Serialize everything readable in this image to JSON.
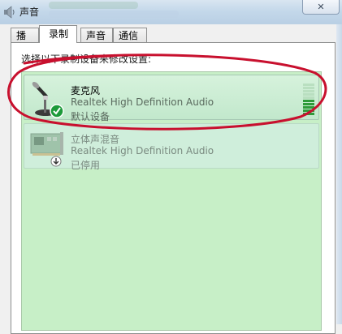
{
  "window": {
    "title": "声音",
    "close_symbol": "✕"
  },
  "tabs": [
    {
      "label": "播放",
      "active": false
    },
    {
      "label": "录制",
      "active": true
    },
    {
      "label": "声音",
      "active": false
    },
    {
      "label": "通信",
      "active": false
    }
  ],
  "recording": {
    "instruction": "选择以下录制设备来修改设置:",
    "devices": [
      {
        "name": "麦克风",
        "driver": "Realtek High Definition Audio",
        "status": "默认设备",
        "icon": "microphone-icon",
        "badge": "default-check-icon",
        "selected": true,
        "level_fraction": 0.5
      },
      {
        "name": "立体声混音",
        "driver": "Realtek High Definition Audio",
        "status": "已停用",
        "icon": "sound-card-icon",
        "badge": "disabled-arrow-icon",
        "selected": false
      }
    ]
  },
  "colors": {
    "list_background": "#c7efc7",
    "annotation": "#c8102e",
    "level_on": "#2f9a3a",
    "check_badge": "#1d9a3a"
  }
}
